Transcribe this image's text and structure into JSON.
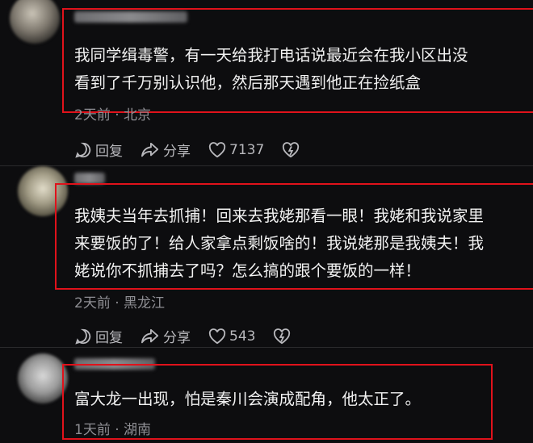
{
  "comments": [
    {
      "text_lines": [
        "我同学缉毒警，有一天给我打电话说最近会在我小区出没",
        "看到了千万别认识他，然后那天遇到他正在捡纸盒"
      ],
      "meta": "2天前 · 北京",
      "reply_label": "回复",
      "share_label": "分享",
      "like_count": "7137"
    },
    {
      "text_lines": [
        "我姨夫当年去抓捕！回来去我姥那看一眼！我姥和我说家里",
        "来要饭的了！给人家拿点剩饭啥的！我说姥那是我姨夫！我",
        "姥说你不抓捕去了吗？怎么搞的跟个要饭的一样！"
      ],
      "meta": "2天前 · 黑龙江",
      "reply_label": "回复",
      "share_label": "分享",
      "like_count": "543"
    },
    {
      "text_lines": [
        "富大龙一出现，怕是秦川会演成配角，他太正了。"
      ],
      "meta": "1天前 · 湖南"
    }
  ],
  "colors": {
    "background": "#0d0d0f",
    "highlight_border": "#e0121b",
    "meta_text": "#8e8e93"
  },
  "icons": [
    "reply-icon",
    "share-icon",
    "like-icon",
    "dislike-icon"
  ]
}
